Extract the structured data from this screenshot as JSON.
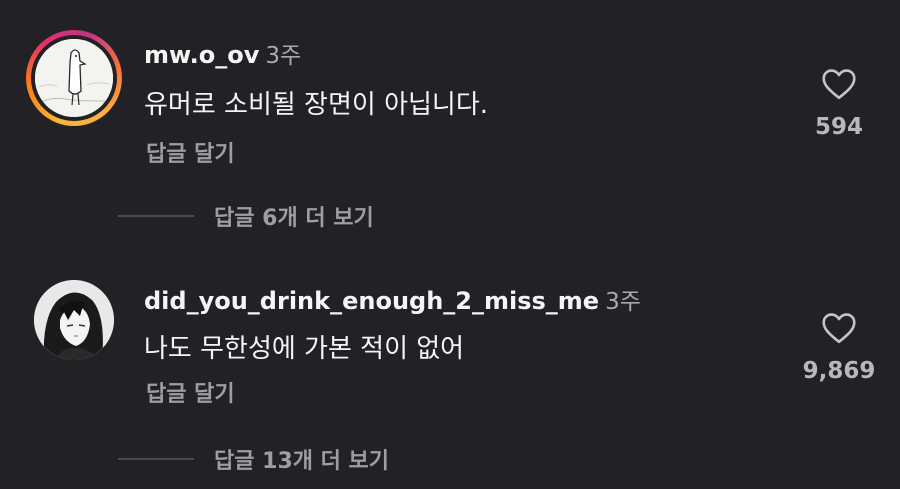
{
  "comments": [
    {
      "username": "mw.o_ov",
      "time": "3주",
      "text": "유머로 소비될 장면이 아닙니다.",
      "reply_label": "답글 달기",
      "likes": "594",
      "more_replies": "답글 6개 더 보기",
      "avatar": "bird-sketch-avatar"
    },
    {
      "username": "did_you_drink_enough_2_miss_me",
      "time": "3주",
      "text": "나도 무한성에 가본 적이 없어",
      "reply_label": "답글 달기",
      "likes": "9,869",
      "more_replies": "답글 13개 더 보기",
      "avatar": "manga-character-avatar"
    }
  ],
  "colors": {
    "background": "#212126",
    "muted": "#9d9da3",
    "ring": "#e1306c"
  }
}
